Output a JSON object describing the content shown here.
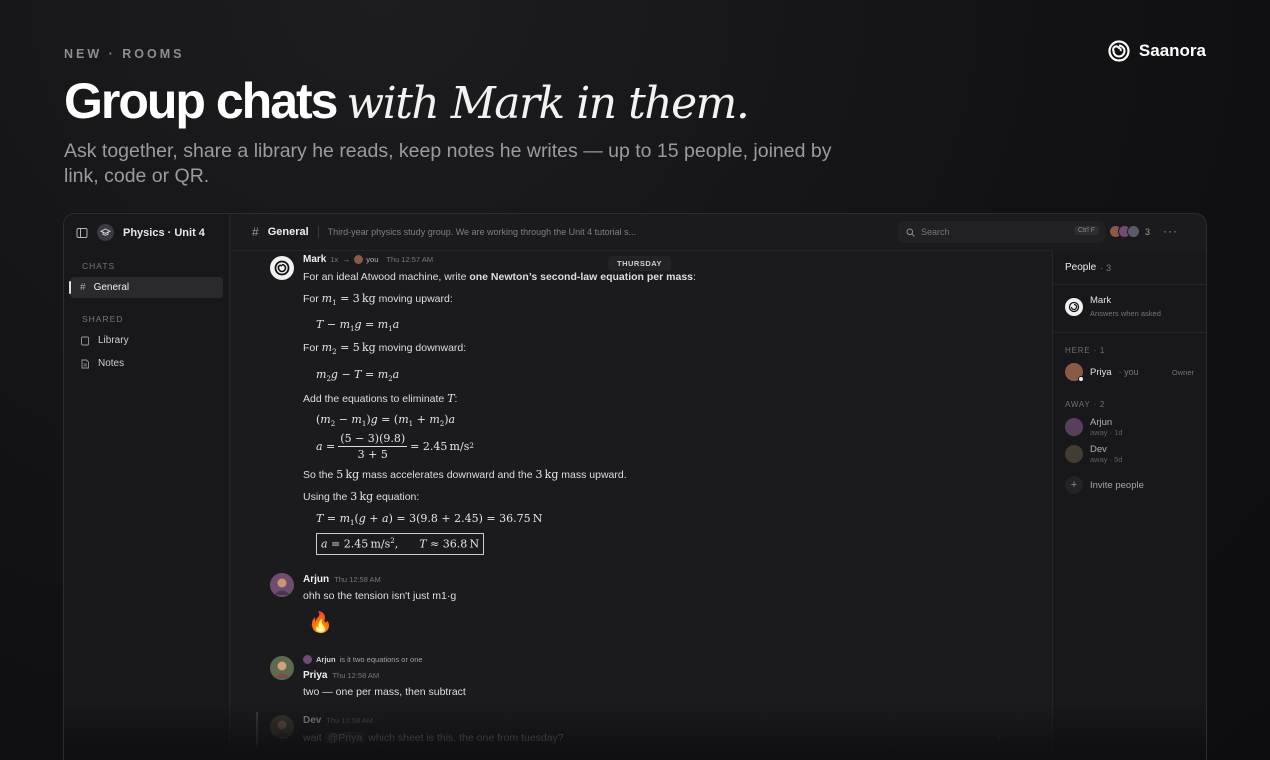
{
  "page": {
    "eyebrow": "NEW · ROOMS",
    "brand": "Saanora",
    "headline_bold": "Group chats",
    "headline_italic": "with Mark in them.",
    "subhead": "Ask together, share a library he reads, keep notes he writes — up to 15 people, joined by link, code or QR."
  },
  "app": {
    "room_name": "Physics · Unit 4",
    "sidebar": {
      "chats_label": "CHATS",
      "shared_label": "SHARED",
      "chats": [
        {
          "label": "General",
          "active": true
        }
      ],
      "shared": [
        {
          "label": "Library",
          "icon": "book-icon"
        },
        {
          "label": "Notes",
          "icon": "note-icon"
        }
      ]
    },
    "channel": {
      "name": "General",
      "description": "Third-year physics study group. We are working through the Unit 4 tutorial s..."
    },
    "search": {
      "placeholder": "Search",
      "shortcut": "Ctrl F"
    },
    "member_count": "3",
    "day_divider": "THURSDAY",
    "messages": {
      "mark": {
        "name": "Mark",
        "badge": "1x",
        "to": "you",
        "time": "Thu 12:57 AM",
        "intro_prefix": "For an ideal Atwood machine, write ",
        "intro_bold": "one Newton’s second-law equation per mass",
        "intro_suffix": ":",
        "line_m1_prefix": "For ",
        "line_m1_suffix": " moving upward:",
        "line_m2_prefix": "For ",
        "line_m2_suffix": " moving downward:",
        "add_prefix": "Add the equations to eliminate ",
        "add_suffix": ":",
        "so_prefix": "So the ",
        "so_mid": " mass accelerates downward and the ",
        "so_suffix": " mass upward.",
        "using_prefix": "Using the ",
        "using_suffix": " equation:"
      },
      "arjun": {
        "name": "Arjun",
        "time": "Thu 12:58 AM",
        "text": "ohh so the tension isn't just m1·g",
        "emoji": "🔥"
      },
      "priya": {
        "name": "Priya",
        "time": "Thu 12:58 AM",
        "reply_to": "Arjun",
        "reply_text": "is it two equations or one",
        "text": "two — one per mass, then subtract"
      },
      "dev": {
        "name": "Dev",
        "time": "Thu 12:58 AM",
        "text_prefix": "wait ",
        "mention": "@Priya",
        "text_suffix": " which sheet is this, the one from tuesday?"
      }
    },
    "people": {
      "title": "People",
      "count": "3",
      "mark": {
        "name": "Mark",
        "sub": "Answers when asked"
      },
      "here_label": "HERE · 1",
      "away_label": "AWAY · 2",
      "priya": {
        "name": "Priya",
        "you": "· you",
        "role": "Owner"
      },
      "arjun": {
        "name": "Arjun",
        "sub": "away · 1d"
      },
      "dev": {
        "name": "Dev",
        "sub": "away · 5d"
      },
      "invite": "Invite people"
    }
  },
  "colors": {
    "background": "#121214",
    "panel": "#1b1b1e",
    "accent_text": "#ffffff"
  }
}
